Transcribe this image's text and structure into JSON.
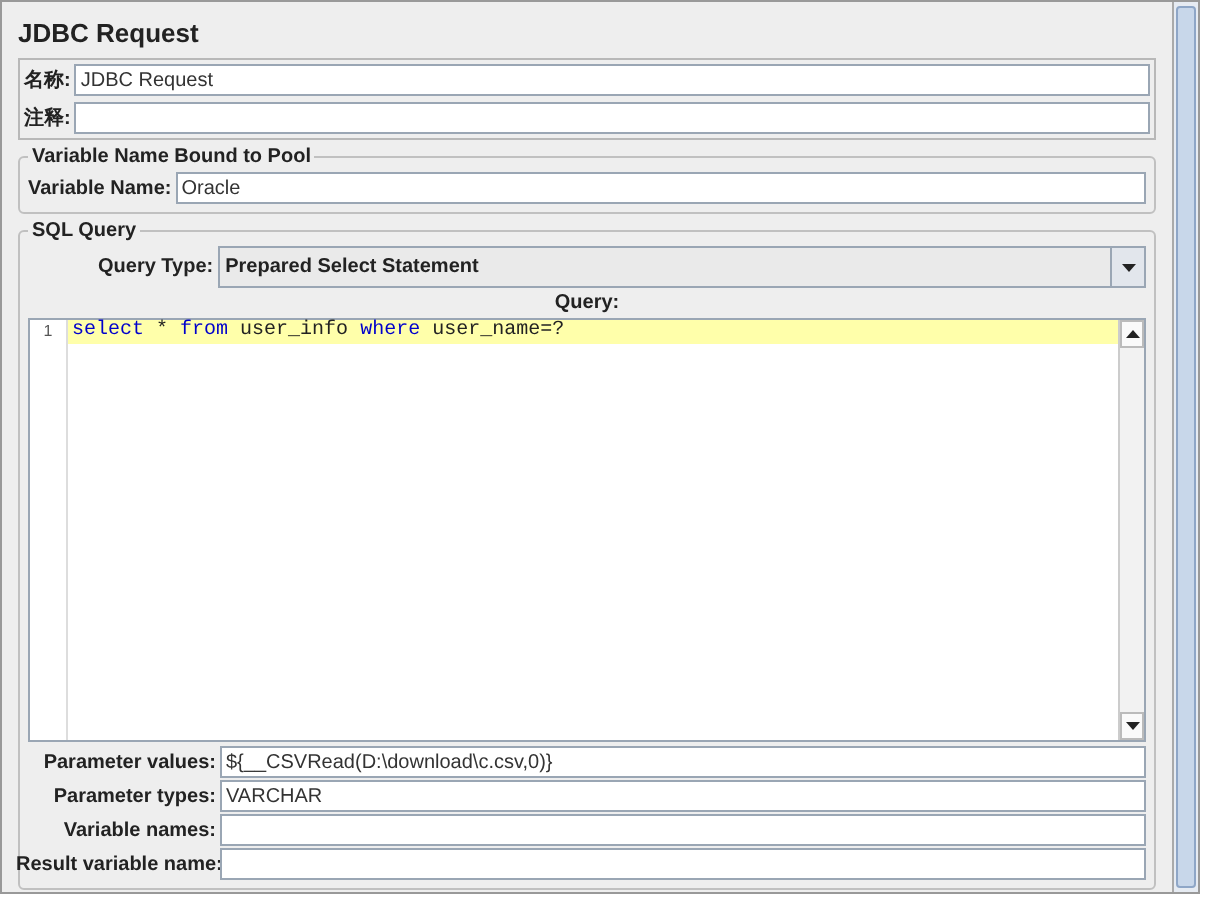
{
  "panel": {
    "title": "JDBC Request"
  },
  "name_field": {
    "label": "名称:",
    "value": "JDBC Request"
  },
  "comment_field": {
    "label": "注释:"
  },
  "pool_group": {
    "title": "Variable Name Bound to Pool",
    "label": "Variable Name:",
    "value": "Oracle"
  },
  "sql_group": {
    "title": "SQL Query",
    "query_type_label": "Query Type:",
    "query_type": "Prepared Select Statement",
    "query_label": "Query:",
    "editor": {
      "lines": [
        {
          "number": "1",
          "highlighted": true,
          "tokens": [
            {
              "kind": "keyword",
              "text": "select"
            },
            {
              "kind": "plain",
              "text": " * "
            },
            {
              "kind": "keyword",
              "text": "from"
            },
            {
              "kind": "plain",
              "text": " user_info "
            },
            {
              "kind": "keyword",
              "text": "where"
            },
            {
              "kind": "plain",
              "text": " user_name=?"
            }
          ]
        }
      ]
    }
  },
  "parameters": [
    {
      "label": "Parameter values:",
      "value": "${__CSVRead(D:\\download\\c.csv,0)}"
    },
    {
      "label": "Parameter types:",
      "value": "VARCHAR"
    },
    {
      "label": "Variable names:"
    },
    {
      "label": "Result variable name:"
    }
  ]
}
